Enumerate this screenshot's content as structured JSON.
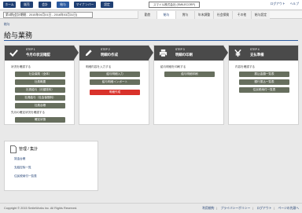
{
  "topnav": {
    "tabs": [
      "ホーム",
      "販売",
      "会計",
      "給与",
      "マイナンバー",
      "設定"
    ],
    "company": "スマイル株式会社 (SMILECORP)",
    "links": [
      "ログアウト",
      "ヘルプ"
    ]
  },
  "subbar": {
    "period": "第3期(会計期間：2015年04月01日 - 2016年03月31日)",
    "tabs": [
      "勤怠",
      "給与",
      "賞与",
      "年末調整",
      "社会保険",
      "その他",
      "給与設定"
    ]
  },
  "breadcrumb": "給与",
  "page_title": "給与業務",
  "steps": [
    {
      "no": "STEP 1",
      "name": "今月の状況確認",
      "lead": "状況を確認する",
      "buttons": [
        "社会保険（全体）",
        "社員概要",
        "社員給与（月額賃料）",
        "社員給与（社会保険料）",
        "社員台帳"
      ],
      "lead2": "先月の確定状況を確認する",
      "buttons2": [
        "確定状態"
      ]
    },
    {
      "no": "STEP 2",
      "name": "明細の作成",
      "lead": "明細内容を入力する",
      "buttons": [
        "給与明細入力",
        "給与明細インポート"
      ],
      "red": "明細作成"
    },
    {
      "no": "STEP 3",
      "name": "明細の印刷",
      "lead": "給与明細を印刷する",
      "buttons": [
        "給与明細印刷"
      ]
    },
    {
      "no": "STEP 4",
      "name": "支払準備",
      "lead": "内容を確認する",
      "buttons": [
        "振込金額一覧表",
        "銀行振込一覧表",
        "住民税納付一覧表"
      ]
    }
  ],
  "manage": {
    "title": "管理 / 集計",
    "links": [
      "賃金台帳",
      "支給控除一覧",
      "住民税納付一覧表"
    ]
  },
  "footer": {
    "copyright": "Copyright © 2015 SmileWorks Inc. All Rights Reserved.",
    "links": [
      "利用規約",
      "プライバシーポリシー",
      "ログアウト",
      "ページの先頭へ"
    ]
  },
  "colors": {
    "nav": "#1f3f73",
    "step_head": "#4a4a4a",
    "button": "#676f5e",
    "primary_red": "#d9322b"
  }
}
